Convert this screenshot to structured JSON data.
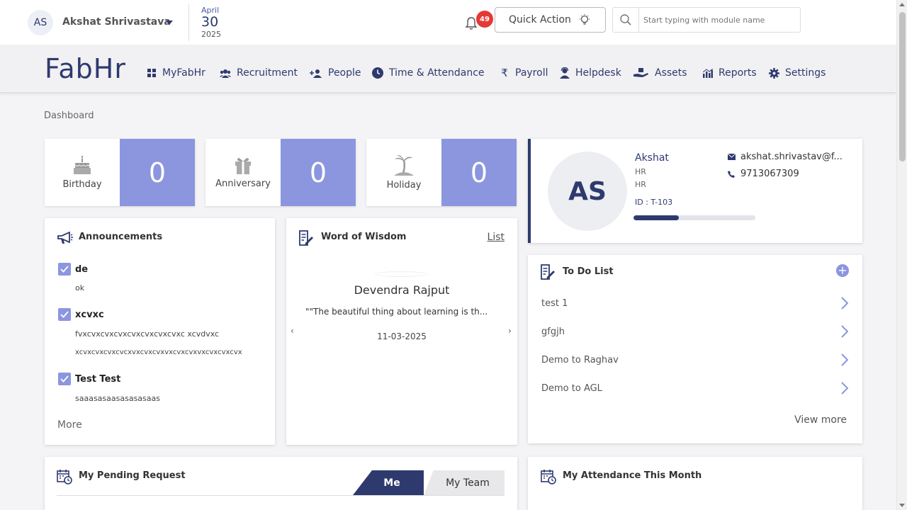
{
  "user": {
    "initials": "AS",
    "name": "Akshat Shrivastava"
  },
  "date": {
    "month": "April",
    "day": "30",
    "year": "2025"
  },
  "notifications": {
    "count": "49"
  },
  "quick_action": {
    "label": "Quick Action"
  },
  "search": {
    "placeholder": "Start typing with module name"
  },
  "logo": "FabHr",
  "nav": [
    {
      "label": "MyFabHr",
      "icon": "grid-icon"
    },
    {
      "label": "Recruitment",
      "icon": "group-icon"
    },
    {
      "label": "People",
      "icon": "person-add-icon"
    },
    {
      "label": "Time & Attendance",
      "icon": "clock-icon"
    },
    {
      "label": "Payroll",
      "icon": "rupee-icon"
    },
    {
      "label": "Helpdesk",
      "icon": "support-agent-icon"
    },
    {
      "label": "Assets",
      "icon": "hand-box-icon"
    },
    {
      "label": "Reports",
      "icon": "chart-icon"
    },
    {
      "label": "Settings",
      "icon": "gear-icon"
    }
  ],
  "breadcrumb": "Dashboard",
  "stats": [
    {
      "label": "Birthday",
      "value": "0",
      "icon": "cake-icon"
    },
    {
      "label": "Anniversary",
      "value": "0",
      "icon": "gift-icon"
    },
    {
      "label": "Holiday",
      "value": "0",
      "icon": "palm-tree-icon"
    }
  ],
  "profile": {
    "initials": "AS",
    "name": "Akshat",
    "role1": "HR",
    "role2": "HR",
    "id": "ID : T-103",
    "email": "akshat.shrivastav@f...",
    "phone": "9713067309",
    "progress": 0.37
  },
  "announcements": {
    "title": "Announcements",
    "items": [
      {
        "title": "de",
        "lines": [
          "ok"
        ]
      },
      {
        "title": "xcvxc",
        "lines": [
          "fvxcvxcvxcvxcvxcvxcvxcvxc xcvdvxc",
          "xcvxcvxcvxcvcxvxcvxcvxvxcvxcvxvxcvxcvxcvx"
        ]
      },
      {
        "title": "Test Test",
        "lines": [
          "saaasasaasasasasaas"
        ]
      }
    ],
    "more": "More"
  },
  "wisdom": {
    "title": "Word of Wisdom",
    "list": "List",
    "author": "Devendra Rajput",
    "quote": "\"\"The beautiful thing about learning is th...",
    "date": "11-03-2025",
    "prev": "‹",
    "next": "›"
  },
  "todo": {
    "title": "To Do List",
    "add": "+",
    "items": [
      "test 1",
      "gfgjh",
      "Demo to Raghav",
      "Demo to AGL"
    ],
    "view_more": "View more"
  },
  "pending": {
    "title": "My Pending Request",
    "tab_me": "Me",
    "tab_team": "My Team"
  },
  "attendance": {
    "title": "My Attendance This Month"
  },
  "colors": {
    "primary": "#2e3a6e",
    "accent": "#8b96df",
    "badge": "#e53935"
  }
}
